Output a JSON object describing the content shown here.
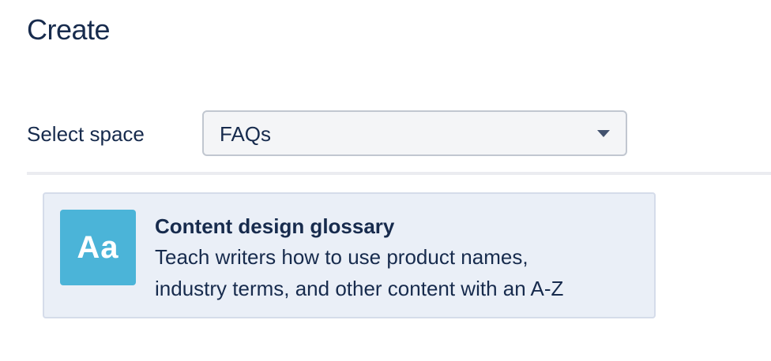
{
  "page": {
    "title": "Create"
  },
  "space": {
    "label": "Select space",
    "selected": "FAQs"
  },
  "template": {
    "icon_text": "Aa",
    "icon_name": "glossary-icon",
    "icon_color": "#4bb4d8",
    "title": "Content design glossary",
    "description_line1": "Teach writers how to use product names,",
    "description_line2": "industry terms, and other content with an A-Z"
  }
}
